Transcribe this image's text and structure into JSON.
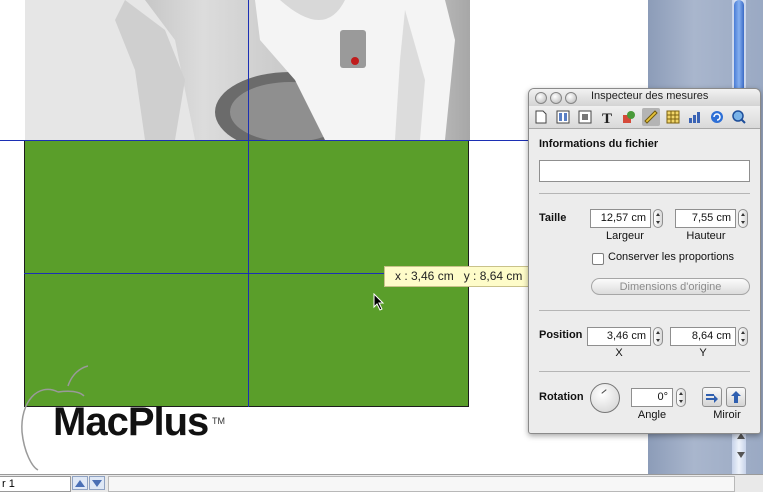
{
  "coord_tooltip": {
    "x": "x : 3,46 cm",
    "y": "y : 8,64 cm"
  },
  "logo": {
    "text": "MacPlus",
    "trademark": "TM"
  },
  "status_bar": {
    "page_field": "r 1"
  },
  "inspector": {
    "title": "Inspecteur des mesures",
    "file_info_label": "Informations du fichier",
    "file_info_value": "",
    "size_label": "Taille",
    "width_value": "12,57 cm",
    "width_label": "Largeur",
    "height_value": "7,55 cm",
    "height_label": "Hauteur",
    "keep_proportions_label": "Conserver les proportions",
    "keep_proportions_checked": false,
    "original_size_button": "Dimensions d'origine",
    "position_label": "Position",
    "x_value": "3,46 cm",
    "x_label": "X",
    "y_value": "8,64 cm",
    "y_label": "Y",
    "rotation_label": "Rotation",
    "angle_value": "0°",
    "angle_label": "Angle",
    "mirror_label": "Miroir",
    "toolbar_icons": [
      "document-icon",
      "layout-icon",
      "wrap-icon",
      "text-icon",
      "graphic-icon",
      "ruler-icon",
      "table-icon",
      "chart-icon",
      "link-icon",
      "quicktime-icon"
    ],
    "active_tool": "ruler-icon"
  },
  "colors": {
    "shape_fill": "#5a9e2a",
    "guide": "#1c2fb4",
    "tooltip_bg": "#fefcc9"
  }
}
